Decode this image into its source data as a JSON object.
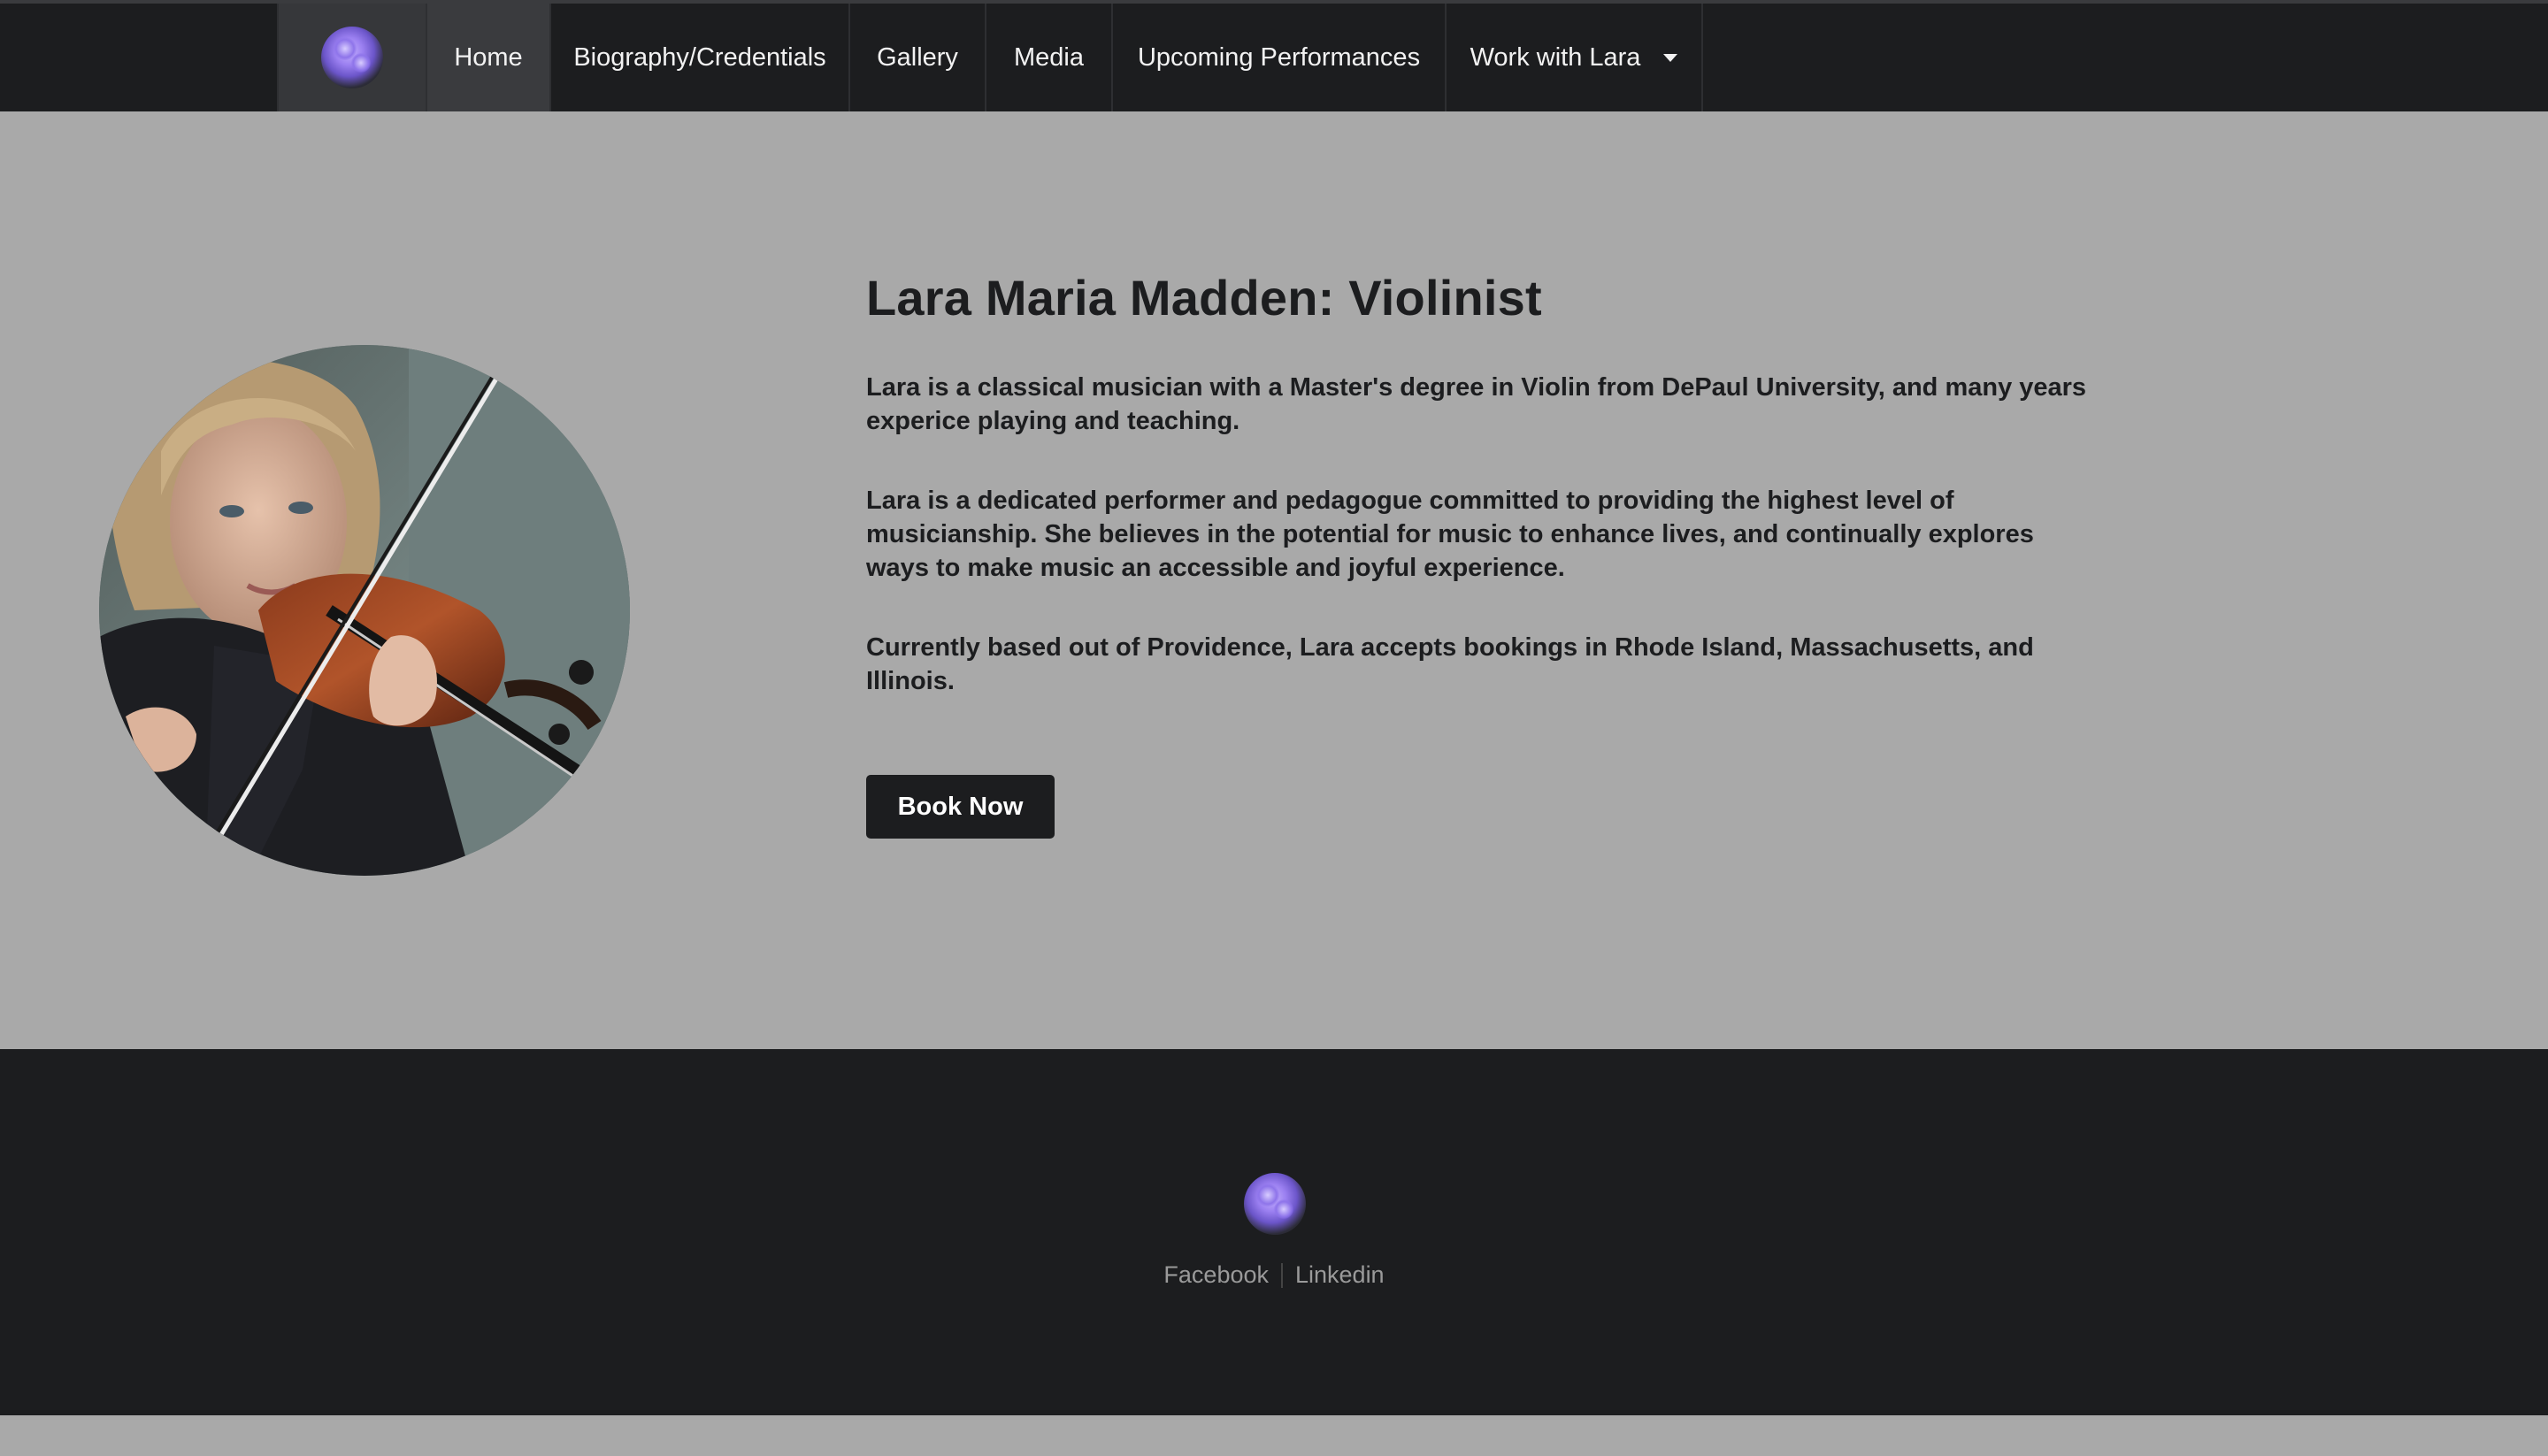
{
  "nav": {
    "logo_icon": "amethyst-logo-icon",
    "items": [
      {
        "label": "Home",
        "active": true
      },
      {
        "label": "Biography/Credentials"
      },
      {
        "label": "Gallery"
      },
      {
        "label": "Media"
      },
      {
        "label": "Upcoming Performances"
      },
      {
        "label": "Work with Lara",
        "dropdown": true
      }
    ]
  },
  "hero": {
    "title": "Lara Maria Madden: Violinist",
    "paragraphs": [
      "Lara is a classical musician with a Master's degree in Violin from DePaul University, and many years experice playing and teaching.",
      "Lara is a dedicated performer and pedagogue committed to providing the highest level of musicianship. She believes in the potential for music to enhance lives, and continually explores ways to make music an accessible and joyful experience.",
      "Currently based out of Providence, Lara accepts bookings in Rhode Island, Massachusetts, and Illinois."
    ],
    "cta_label": "Book Now"
  },
  "footer": {
    "logo_icon": "amethyst-logo-icon",
    "links": [
      "Facebook",
      "Linkedin"
    ]
  },
  "colors": {
    "nav_bg": "#1c1d1f",
    "hero_bg": "#a9a9a9",
    "accent_gem": "#9a7ff0"
  }
}
